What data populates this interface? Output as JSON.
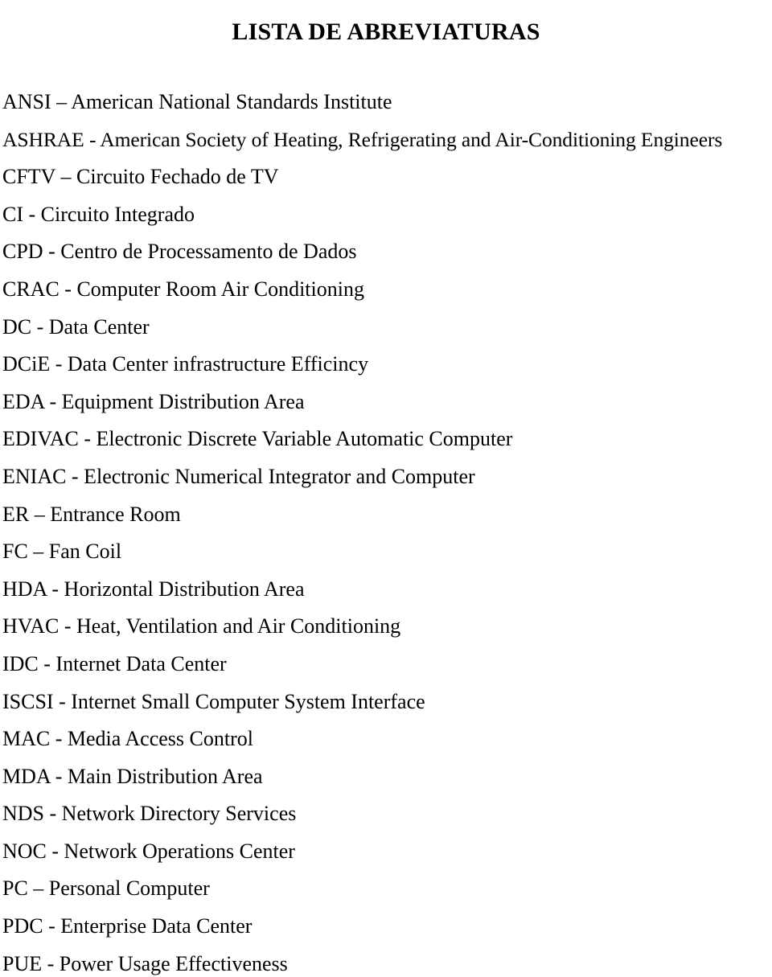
{
  "document": {
    "title": "LISTA DE ABREVIATURAS",
    "language": "pt-BR",
    "entries": [
      {
        "text": "ANSI – American National Standards Institute"
      },
      {
        "text": "ASHRAE - American Society of Heating, Refrigerating and Air-Conditioning Engineers"
      },
      {
        "text": "CFTV – Circuito Fechado de TV"
      },
      {
        "text": "CI - Circuito Integrado"
      },
      {
        "text": "CPD - Centro de Processamento de Dados"
      },
      {
        "text": "CRAC - Computer Room Air Conditioning"
      },
      {
        "text": "DC - Data Center"
      },
      {
        "text": "DCiE - Data Center infrastructure Efficincy"
      },
      {
        "text": "EDA - Equipment Distribution Area"
      },
      {
        "text": "EDIVAC - Electronic Discrete Variable Automatic Computer"
      },
      {
        "text": "ENIAC -  Electronic Numerical Integrator and Computer"
      },
      {
        "text": "ER – Entrance Room"
      },
      {
        "text": "FC – Fan Coil"
      },
      {
        "text": "HDA - Horizontal Distribution Area"
      },
      {
        "text": "HVAC - Heat, Ventilation and Air Conditioning"
      },
      {
        "text": "IDC - Internet Data Center"
      },
      {
        "text": "ISCSI - Internet Small Computer System Interface"
      },
      {
        "text": "MAC - Media Access Control"
      },
      {
        "text": "MDA - Main Distribution Area"
      },
      {
        "text": "NDS - Network Directory Services"
      },
      {
        "text": "NOC - Network Operations Center"
      },
      {
        "text": "PC – Personal Computer"
      },
      {
        "text": "PDC - Enterprise Data Center"
      },
      {
        "text": "PUE - Power Usage Effectiveness"
      }
    ]
  }
}
